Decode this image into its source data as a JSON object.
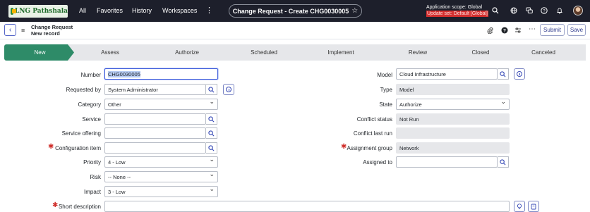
{
  "topnav": {
    "logo_text": "LNG Pathshala",
    "links": [
      "All",
      "Favorites",
      "History",
      "Workspaces"
    ],
    "record_title": "Change Request - Create CHG0030005",
    "scope_line1": "Application scope: Global",
    "scope_line2": "Update set: Default [Global]",
    "icons": [
      "search-icon",
      "globe-icon",
      "chat-icon",
      "help-icon",
      "bell-icon"
    ]
  },
  "form_header": {
    "title": "Change Request",
    "subtitle": "New record",
    "submit_label": "Submit",
    "save_label": "Save"
  },
  "stages": [
    "New",
    "Assess",
    "Authorize",
    "Scheduled",
    "Implement",
    "Review",
    "Closed",
    "Canceled"
  ],
  "active_stage": "New",
  "colors": {
    "nav_bg": "#1d1f2b",
    "active_stage": "#2e8b68",
    "accent": "#3447b5",
    "required": "#d0312d"
  },
  "left": {
    "number": {
      "label": "Number",
      "value": "CHG0030005"
    },
    "requested_by": {
      "label": "Requested by",
      "value": "System Administrator"
    },
    "category": {
      "label": "Category",
      "value": "Other"
    },
    "service": {
      "label": "Service",
      "value": ""
    },
    "service_offering": {
      "label": "Service offering",
      "value": ""
    },
    "configuration_item": {
      "label": "Configuration item",
      "value": ""
    },
    "priority": {
      "label": "Priority",
      "value": "4 - Low"
    },
    "risk": {
      "label": "Risk",
      "value": "-- None --"
    },
    "impact": {
      "label": "Impact",
      "value": "3 - Low"
    },
    "short_description": {
      "label": "Short description",
      "value": ""
    }
  },
  "right": {
    "model": {
      "label": "Model",
      "value": "Cloud Infrastructure"
    },
    "type": {
      "label": "Type",
      "value": "Model"
    },
    "state": {
      "label": "State",
      "value": "Authorize"
    },
    "conflict_status": {
      "label": "Conflict status",
      "value": "Not Run"
    },
    "conflict_last_run": {
      "label": "Conflict last run",
      "value": ""
    },
    "assignment_group": {
      "label": "Assignment group",
      "value": "Network"
    },
    "assigned_to": {
      "label": "Assigned to",
      "value": ""
    }
  }
}
